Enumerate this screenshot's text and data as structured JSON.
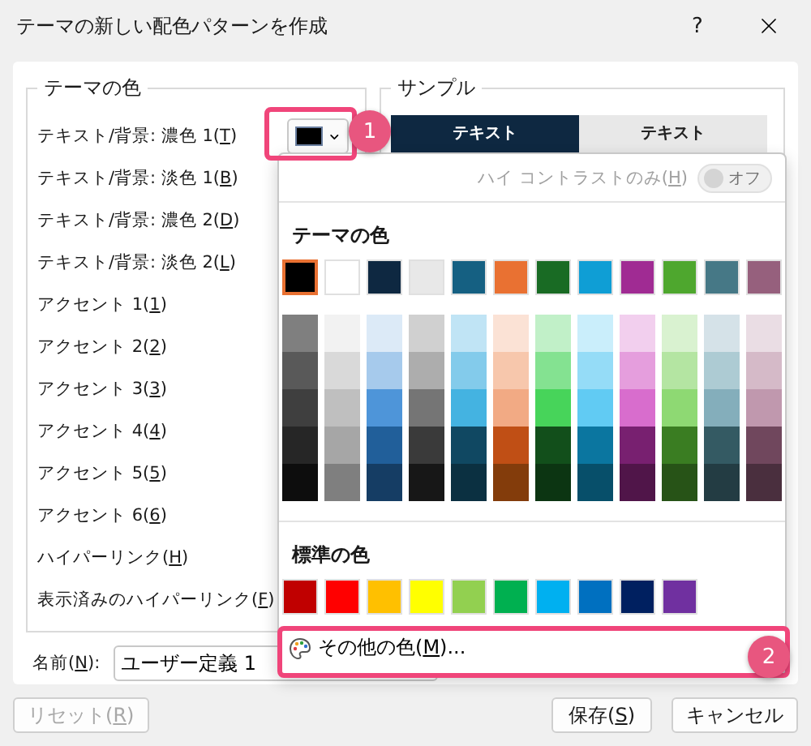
{
  "window": {
    "title": "テーマの新しい配色パターンを作成",
    "help": "?"
  },
  "theme_colors_group": {
    "legend": "テーマの色",
    "rows": [
      {
        "pre": "テキスト/背景: 濃色 1(",
        "key": "T",
        "post": ")"
      },
      {
        "pre": "テキスト/背景: 淡色 1(",
        "key": "B",
        "post": ")"
      },
      {
        "pre": "テキスト/背景: 濃色 2(",
        "key": "D",
        "post": ")"
      },
      {
        "pre": "テキスト/背景: 淡色 2(",
        "key": "L",
        "post": ")"
      },
      {
        "pre": "アクセント 1(",
        "key": "1",
        "post": ")"
      },
      {
        "pre": "アクセント 2(",
        "key": "2",
        "post": ")"
      },
      {
        "pre": "アクセント 3(",
        "key": "3",
        "post": ")"
      },
      {
        "pre": "アクセント 4(",
        "key": "4",
        "post": ")"
      },
      {
        "pre": "アクセント 5(",
        "key": "5",
        "post": ")"
      },
      {
        "pre": "アクセント 6(",
        "key": "6",
        "post": ")"
      },
      {
        "pre": "ハイパーリンク(",
        "key": "H",
        "post": ")"
      },
      {
        "pre": "表示済みのハイパーリンク(",
        "key": "F",
        "post": ")"
      }
    ],
    "picker": {
      "color": "#000000",
      "expanded": true
    }
  },
  "sample_group": {
    "legend": "サンプル",
    "cells": [
      {
        "text": "テキスト",
        "color": "#0e2841"
      },
      {
        "text": "テキスト",
        "color": "#e8e8e8"
      }
    ]
  },
  "name_field": {
    "pre": "名前(",
    "key": "N",
    "post": "):",
    "value": "ユーザー定義 1"
  },
  "popup": {
    "high_contrast": {
      "pre": "ハイ コントラストのみ(",
      "key": "H",
      "post": ")",
      "state_text": "オフ",
      "on": false,
      "disabled": true
    },
    "theme_heading": "テーマの色",
    "theme_colors": [
      {
        "color": "#000000",
        "selected": true,
        "shades": [
          {
            "color": "#7f7f7f"
          },
          {
            "color": "#595959"
          },
          {
            "color": "#3f3f3f"
          },
          {
            "color": "#262626"
          },
          {
            "color": "#0d0d0d"
          }
        ]
      },
      {
        "color": "#ffffff",
        "selected": false,
        "shades": [
          {
            "color": "#f2f2f2"
          },
          {
            "color": "#d9d9d9"
          },
          {
            "color": "#bfbfbf"
          },
          {
            "color": "#a6a6a6"
          },
          {
            "color": "#7f7f7f"
          }
        ]
      },
      {
        "color": "#0e2841",
        "selected": false,
        "shades": [
          {
            "color": "#dceaf7"
          },
          {
            "color": "#a6caec"
          },
          {
            "color": "#4e95d9"
          },
          {
            "color": "#215f9a"
          },
          {
            "color": "#153d64"
          }
        ]
      },
      {
        "color": "#e8e8e8",
        "selected": false,
        "shades": [
          {
            "color": "#d0d0d0"
          },
          {
            "color": "#adadad"
          },
          {
            "color": "#757575"
          },
          {
            "color": "#3a3a3a"
          },
          {
            "color": "#171717"
          }
        ]
      },
      {
        "color": "#156082",
        "selected": false,
        "shades": [
          {
            "color": "#c0e4f5"
          },
          {
            "color": "#83cbeb"
          },
          {
            "color": "#44b3e1"
          },
          {
            "color": "#104862"
          },
          {
            "color": "#0b3041"
          }
        ]
      },
      {
        "color": "#e97132",
        "selected": false,
        "shades": [
          {
            "color": "#fbe2d5"
          },
          {
            "color": "#f7c7ac"
          },
          {
            "color": "#f2aa84"
          },
          {
            "color": "#c04f15"
          },
          {
            "color": "#833c0b"
          }
        ]
      },
      {
        "color": "#196b24",
        "selected": false,
        "shades": [
          {
            "color": "#c1f0c8"
          },
          {
            "color": "#84e291"
          },
          {
            "color": "#47d45a"
          },
          {
            "color": "#124f1b"
          },
          {
            "color": "#0c3512"
          }
        ]
      },
      {
        "color": "#0f9ed5",
        "selected": false,
        "shades": [
          {
            "color": "#caeefb"
          },
          {
            "color": "#95dcf7"
          },
          {
            "color": "#61cbf3"
          },
          {
            "color": "#0b76a0"
          },
          {
            "color": "#074f6a"
          }
        ]
      },
      {
        "color": "#a02b93",
        "selected": false,
        "shades": [
          {
            "color": "#f2cfee"
          },
          {
            "color": "#e59edd"
          },
          {
            "color": "#d86dcd"
          },
          {
            "color": "#782070"
          },
          {
            "color": "#501549"
          }
        ]
      },
      {
        "color": "#4ea72e",
        "selected": false,
        "shades": [
          {
            "color": "#d9f2d0"
          },
          {
            "color": "#b4e5a2"
          },
          {
            "color": "#8ed973"
          },
          {
            "color": "#3a7d22"
          },
          {
            "color": "#275317"
          }
        ]
      },
      {
        "color": "#467886",
        "selected": false,
        "shades": [
          {
            "color": "#d5e2e8"
          },
          {
            "color": "#adcbd3"
          },
          {
            "color": "#84aebb"
          },
          {
            "color": "#345a63"
          },
          {
            "color": "#233c43"
          }
        ]
      },
      {
        "color": "#96607d",
        "selected": false,
        "shades": [
          {
            "color": "#eadde4"
          },
          {
            "color": "#d5bac8"
          },
          {
            "color": "#c098ae"
          },
          {
            "color": "#70475d"
          },
          {
            "color": "#4a2f3e"
          }
        ]
      }
    ],
    "standard_heading": "標準の色",
    "standard_colors": [
      {
        "color": "#c00000"
      },
      {
        "color": "#ff0000"
      },
      {
        "color": "#ffc000"
      },
      {
        "color": "#ffff00"
      },
      {
        "color": "#92d050"
      },
      {
        "color": "#00b050"
      },
      {
        "color": "#00b0f0"
      },
      {
        "color": "#0070c0"
      },
      {
        "color": "#002060"
      },
      {
        "color": "#7030a0"
      }
    ],
    "more_colors": {
      "pre": "その他の色(",
      "key": "M",
      "post": ")..."
    }
  },
  "callouts": [
    {
      "number": "1"
    },
    {
      "number": "2"
    }
  ],
  "buttons": [
    {
      "kind": "left",
      "pre": "リセット(",
      "key": "R",
      "post": ")",
      "disabled": true
    },
    {
      "kind": "right",
      "pre": "保存(",
      "key": "S",
      "post": ")",
      "disabled": false
    },
    {
      "kind": "right",
      "pre": "キャンセル",
      "disabled": false
    }
  ]
}
